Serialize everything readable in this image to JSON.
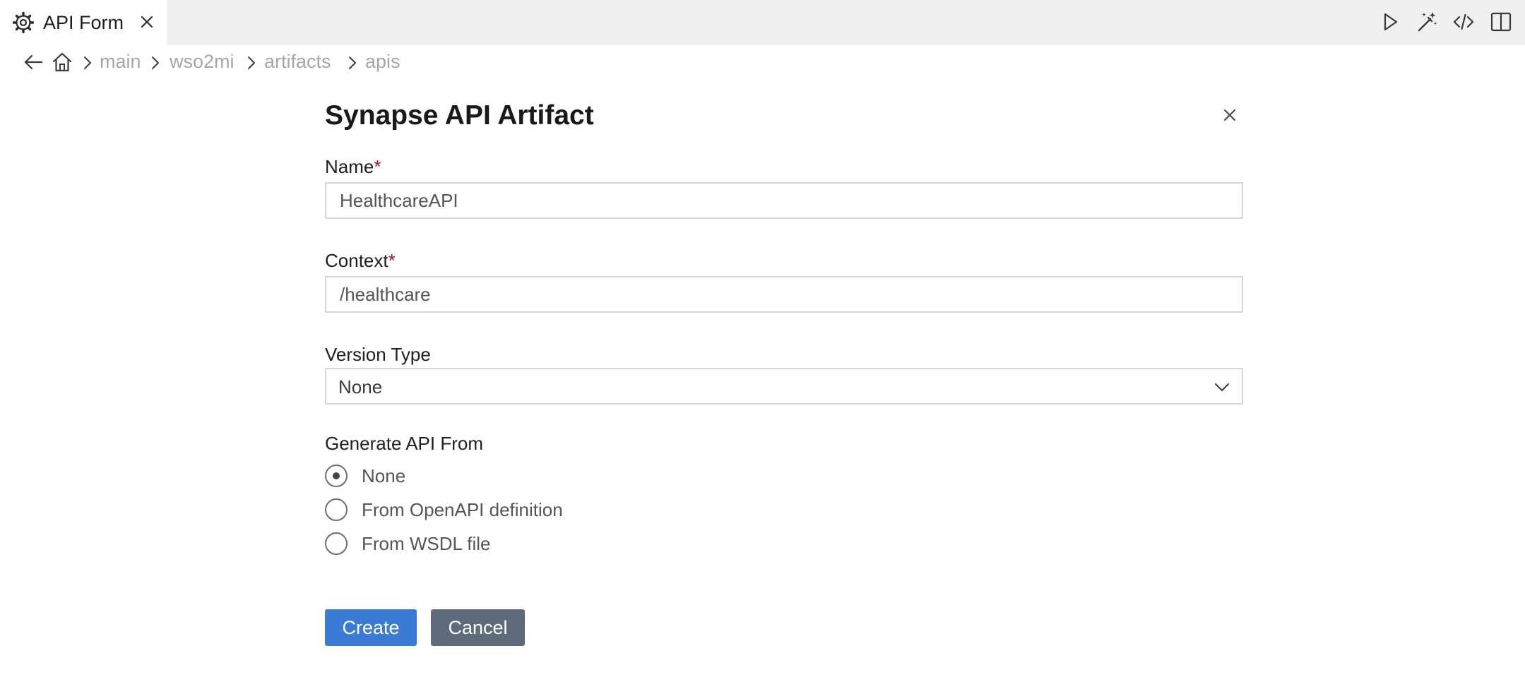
{
  "tab": {
    "icon": "gear-icon",
    "title": "API Form",
    "close_icon": "close-icon"
  },
  "toolbar": {
    "actions": [
      "run-icon",
      "magic-wand-icon",
      "code-icon",
      "split-editor-icon"
    ]
  },
  "breadcrumb": {
    "back_icon": "arrow-left-icon",
    "home_icon": "home-icon",
    "items": [
      "main",
      "wso2mi",
      "artifacts",
      "apis"
    ]
  },
  "form": {
    "title": "Synapse API Artifact",
    "name": {
      "label": "Name",
      "required_mark": "*",
      "value": "HealthcareAPI"
    },
    "context": {
      "label": "Context",
      "required_mark": "*",
      "value": "/healthcare"
    },
    "version_type": {
      "label": "Version Type",
      "selected": "None"
    },
    "generate_from": {
      "label": "Generate API From",
      "options": [
        "None",
        "From OpenAPI definition",
        "From WSDL file"
      ],
      "selected": "None"
    },
    "buttons": {
      "create": "Create",
      "cancel": "Cancel"
    }
  },
  "colors": {
    "tabbar_bg": "#f0f0f0",
    "required": "#9e1a1a",
    "create_button": "#3a7bd5",
    "cancel_button": "#5f6b7a",
    "breadcrumb_text": "#a6a6a6"
  }
}
